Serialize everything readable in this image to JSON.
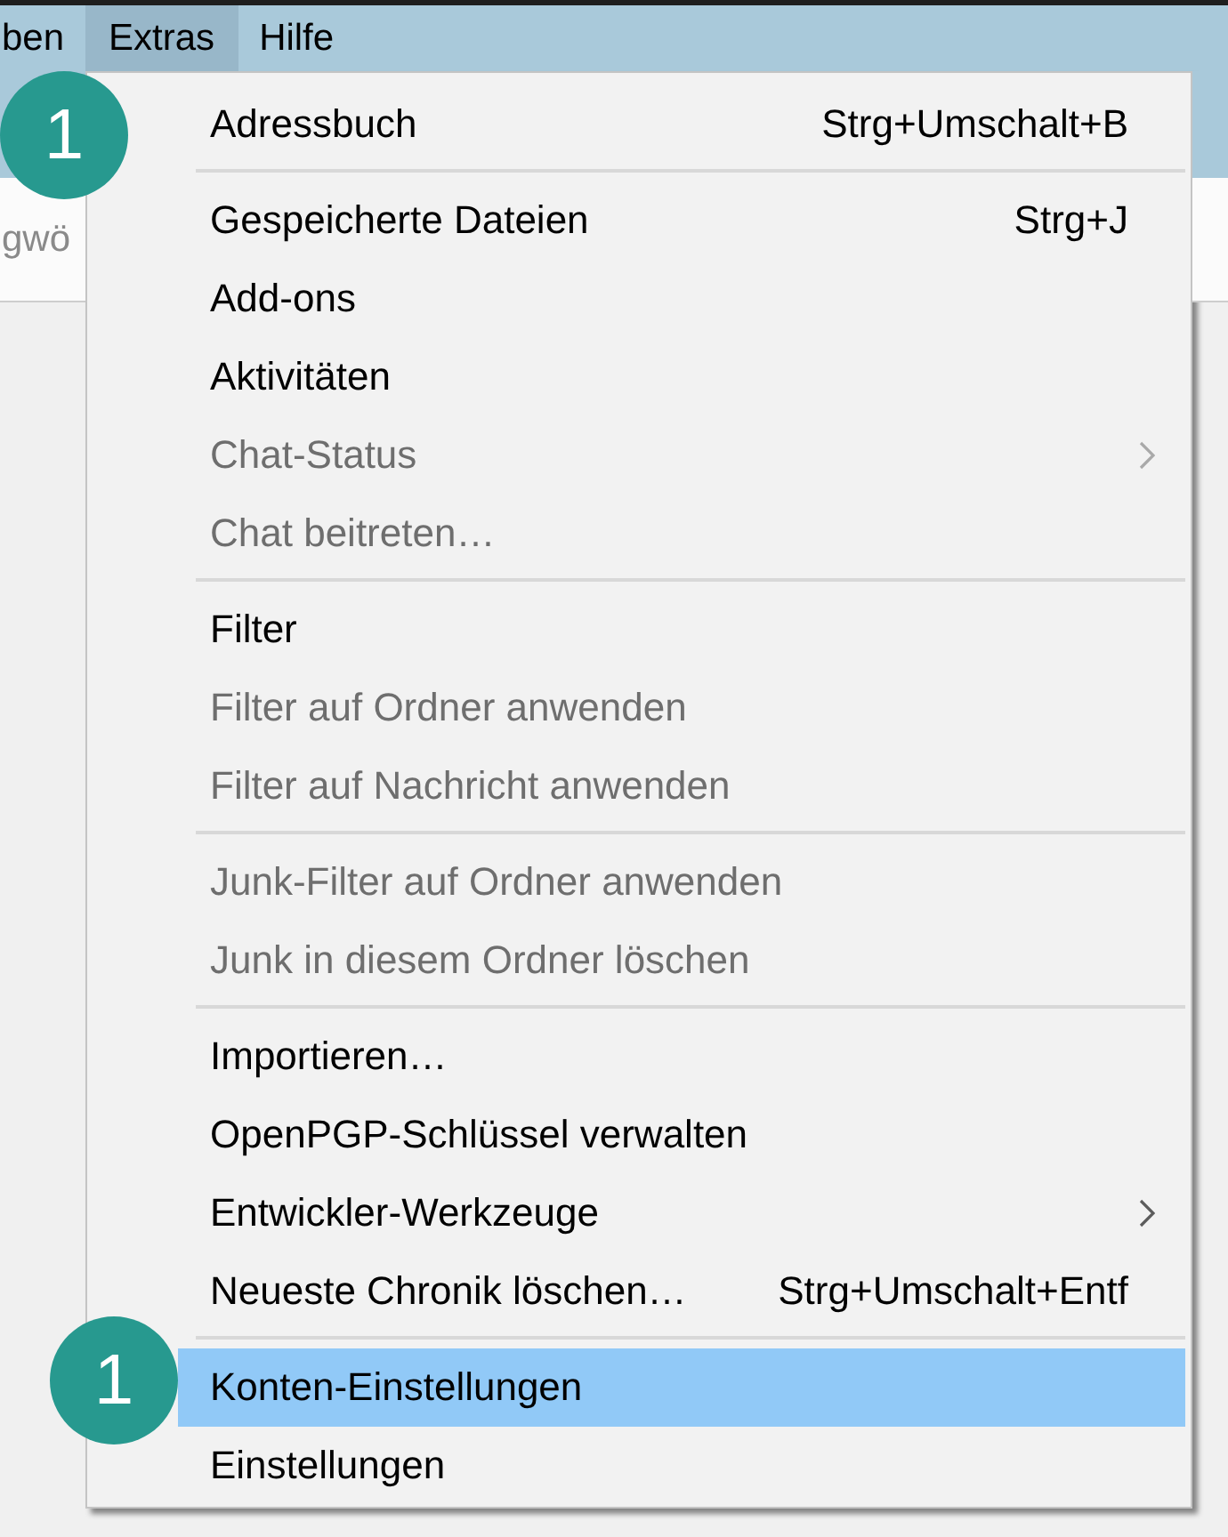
{
  "menu_bar": {
    "items": [
      {
        "label": "ben",
        "selected": false
      },
      {
        "label": "Extras",
        "selected": true,
        "callout": "1"
      },
      {
        "label": "Hilfe",
        "selected": false
      }
    ]
  },
  "search": {
    "placeholder": "gwö"
  },
  "menu": {
    "entries": [
      {
        "kind": "item",
        "label": "Adressbuch",
        "shortcut": "Strg+Umschalt+B",
        "selected": false,
        "disabled": false,
        "submenu": false
      },
      {
        "kind": "separator"
      },
      {
        "kind": "item",
        "label": "Gespeicherte Dateien",
        "shortcut": "Strg+J",
        "selected": false,
        "disabled": false,
        "submenu": false
      },
      {
        "kind": "item",
        "label": "Add-ons",
        "selected": false,
        "disabled": false,
        "submenu": false
      },
      {
        "kind": "item",
        "label": "Aktivitäten",
        "selected": false,
        "disabled": false,
        "submenu": false
      },
      {
        "kind": "item",
        "label": "Chat-Status",
        "selected": false,
        "disabled": true,
        "submenu": true
      },
      {
        "kind": "item",
        "label": "Chat beitreten…",
        "selected": false,
        "disabled": true,
        "submenu": false
      },
      {
        "kind": "separator"
      },
      {
        "kind": "item",
        "label": "Filter",
        "selected": false,
        "disabled": false,
        "submenu": false
      },
      {
        "kind": "item",
        "label": "Filter auf Ordner anwenden",
        "selected": false,
        "disabled": true,
        "submenu": false
      },
      {
        "kind": "item",
        "label": "Filter auf Nachricht anwenden",
        "selected": false,
        "disabled": true,
        "submenu": false
      },
      {
        "kind": "separator"
      },
      {
        "kind": "item",
        "label": "Junk-Filter auf Ordner anwenden",
        "selected": false,
        "disabled": true,
        "submenu": false
      },
      {
        "kind": "item",
        "label": "Junk in diesem Ordner löschen",
        "selected": false,
        "disabled": true,
        "submenu": false
      },
      {
        "kind": "separator"
      },
      {
        "kind": "item",
        "label": "Importieren…",
        "selected": false,
        "disabled": false,
        "submenu": false
      },
      {
        "kind": "item",
        "label": "OpenPGP-Schlüssel verwalten",
        "selected": false,
        "disabled": false,
        "submenu": false
      },
      {
        "kind": "item",
        "label": "Entwickler-Werkzeuge",
        "selected": false,
        "disabled": false,
        "submenu": true
      },
      {
        "kind": "item",
        "label": "Neueste Chronik löschen…",
        "shortcut": "Strg+Umschalt+Entf",
        "selected": false,
        "disabled": false,
        "submenu": false
      },
      {
        "kind": "separator"
      },
      {
        "kind": "item",
        "label": "Konten-Einstellungen",
        "selected": true,
        "disabled": false,
        "submenu": false,
        "callout": "1"
      },
      {
        "kind": "item",
        "label": "Einstellungen",
        "selected": false,
        "disabled": false,
        "submenu": false
      }
    ]
  }
}
